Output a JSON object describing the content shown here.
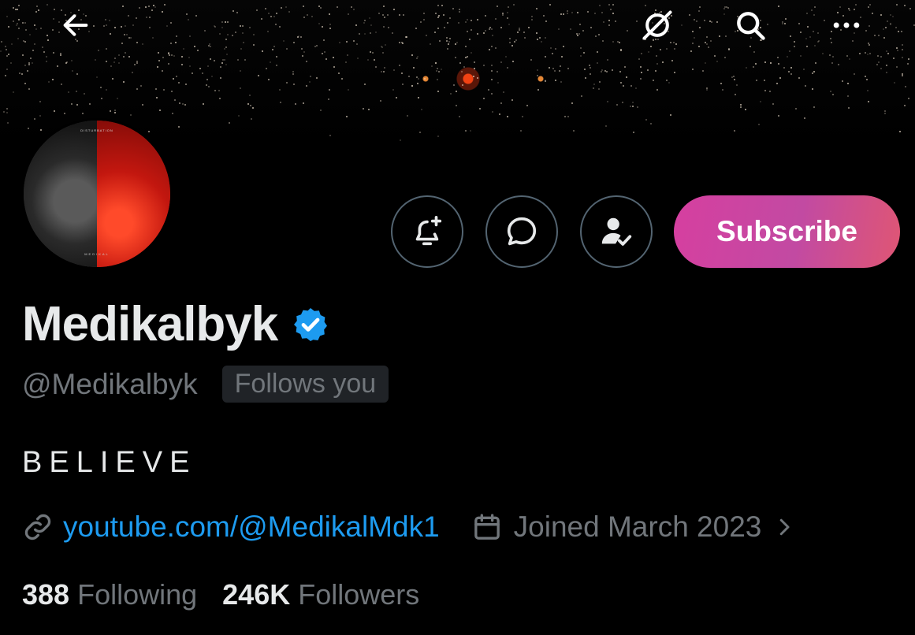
{
  "topbar": {
    "back_icon": "arrow-left-icon",
    "grok_icon": "grok-icon",
    "search_icon": "search-icon",
    "more_icon": "more-horizontal-icon"
  },
  "avatar": {
    "art_tag": "DISTURBATION",
    "art_bottom": "MEDIKAL"
  },
  "actions": {
    "notify_icon": "bell-plus-icon",
    "message_icon": "message-icon",
    "follow_icon": "user-check-icon",
    "subscribe_label": "Subscribe",
    "subscribe_colors": [
      "#d63fa0",
      "#df5674"
    ]
  },
  "profile": {
    "display_name": "Medikalbyk",
    "verified_color": "#1d9bf0",
    "handle": "@Medikalbyk",
    "follows_you": "Follows you",
    "bio": "BELIEVE",
    "link": "youtube.com/@MedikalMdk1",
    "joined": "Joined March 2023"
  },
  "stats": {
    "following_count": "388",
    "following_label": "Following",
    "followers_count": "246K",
    "followers_label": "Followers"
  }
}
